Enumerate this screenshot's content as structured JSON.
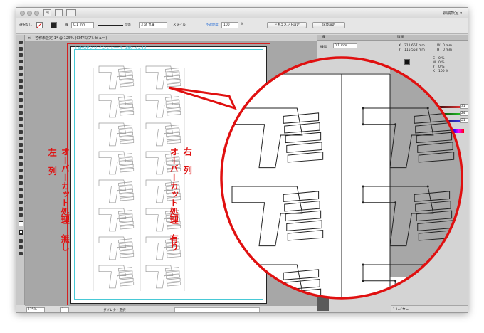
{
  "app": {
    "workspace_label": "初期設定 ▾",
    "document_tab": "名称未設定-1* @ 125% (CMYK/プレビュー)",
    "doc_title_cyan": "TSHOPクリネンジシール 180 x 240"
  },
  "control_bar": {
    "selection_label": "選択なし",
    "stroke_label": "線",
    "stroke_weight": "0.1 mm",
    "uniform_label": "均等",
    "brush_label": "3 pt 丸筆",
    "style_label": "スタイル",
    "opacity_label": "不透明度",
    "opacity_value": "100",
    "percent": "%",
    "document_setup_button": "ドキュメント設定",
    "environment_button": "環境設定"
  },
  "status_bar": {
    "zoom": "125%",
    "page": "1",
    "tool_name": "ダイレクト選択"
  },
  "panels": {
    "stroke_tab": "線",
    "info_tab": "情報",
    "stroke_weight_label": "線幅",
    "stroke_weight_value": "0.1 mm",
    "x_label": "X",
    "x_value": "211.667 mm",
    "y_label": "Y",
    "y_value": "115.558 mm",
    "w_label": "W",
    "w_value": "0 mm",
    "h_label": "H",
    "h_value": "0 mm",
    "c_label": "C",
    "c_value": "0 %",
    "m_label": "M",
    "m_value": "0 %",
    "y2_label": "Y",
    "y2_value": "0 %",
    "k_label": "K",
    "k_value": "100 %",
    "swatch_values": [
      "31",
      "24",
      "21"
    ],
    "layers_label": "1 レイヤー"
  },
  "annotations": {
    "left_column_title": "左 列",
    "left_column_text": "オーバーカット処理 無し",
    "right_column_title": "右 列",
    "right_column_text": "オーバーカット処理 有り"
  },
  "colors": {
    "annotation_red": "#e01010",
    "cyan_guide": "#47c9d6",
    "bleed_red": "#d42020"
  }
}
